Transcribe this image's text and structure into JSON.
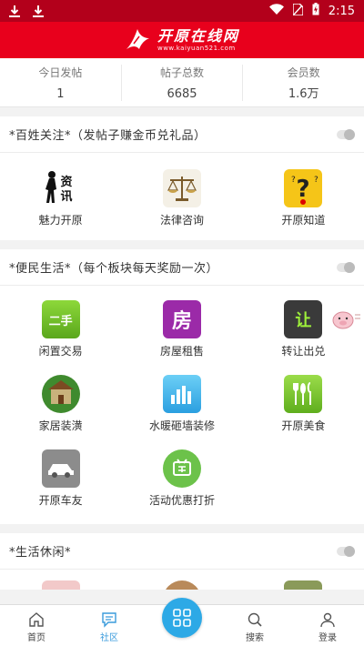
{
  "status_bar": {
    "time": "2:15"
  },
  "app": {
    "title": "开原在线网",
    "url": "www.kaiyuan521.com"
  },
  "stats": [
    {
      "label": "今日发帖",
      "value": "1"
    },
    {
      "label": "帖子总数",
      "value": "6685"
    },
    {
      "label": "会员数",
      "value": "1.6万"
    }
  ],
  "sections": [
    {
      "title": "*百姓关注*（发帖子赚金币兑礼品）",
      "items": [
        {
          "label": "魅力开原",
          "icon": "charm-icon"
        },
        {
          "label": "法律咨询",
          "icon": "scales-icon"
        },
        {
          "label": "开原知道",
          "icon": "question-icon"
        }
      ]
    },
    {
      "title": "*便民生活*（每个板块每天奖励一次）",
      "items": [
        {
          "label": "闲置交易",
          "icon": "secondhand-icon",
          "text": "二手"
        },
        {
          "label": "房屋租售",
          "icon": "house-icon",
          "text": "房"
        },
        {
          "label": "转让出兑",
          "icon": "transfer-icon",
          "text": "让"
        },
        {
          "label": "家居装潢",
          "icon": "home-decor-icon"
        },
        {
          "label": "水暖砸墙装修",
          "icon": "chart-bars-icon"
        },
        {
          "label": "开原美食",
          "icon": "food-icon"
        },
        {
          "label": "开原车友",
          "icon": "car-icon"
        },
        {
          "label": "活动优惠打折",
          "icon": "discount-icon"
        }
      ]
    },
    {
      "title": "*生活休闲*"
    }
  ],
  "tabbar": [
    {
      "label": "首页",
      "icon": "home-icon"
    },
    {
      "label": "社区",
      "icon": "community-icon"
    },
    {
      "label": "",
      "icon": "apps-icon"
    },
    {
      "label": "搜索",
      "icon": "search-icon"
    },
    {
      "label": "登录",
      "icon": "user-icon"
    }
  ],
  "colors": {
    "header": "#e8001c",
    "status_bar": "#b3001b",
    "accent": "#2da9e6"
  }
}
